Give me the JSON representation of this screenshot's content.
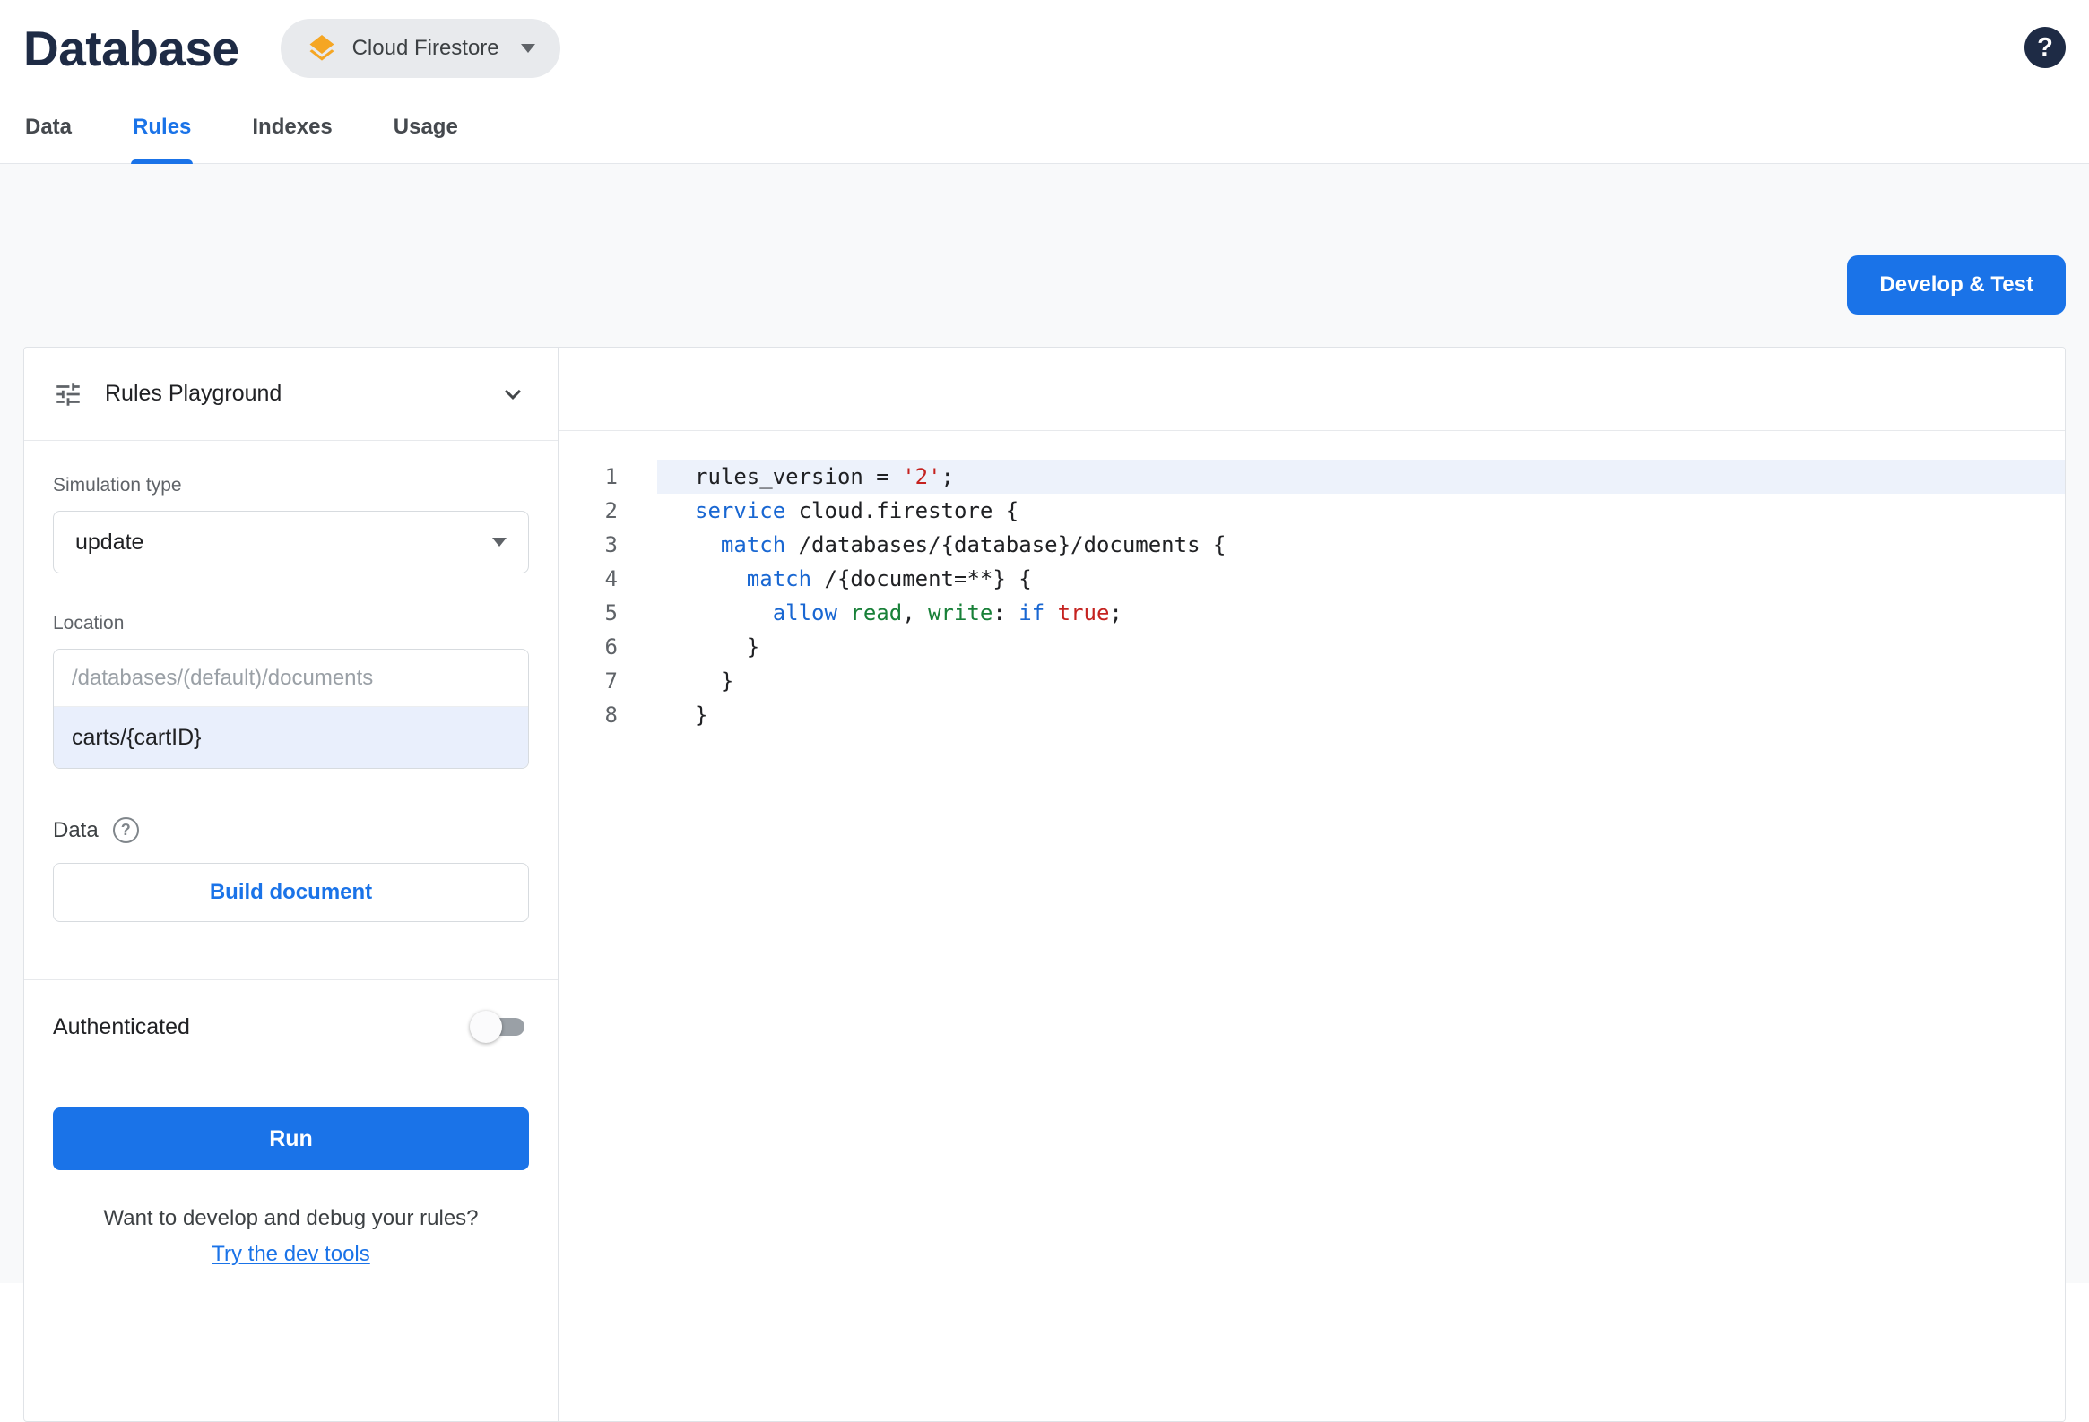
{
  "colors": {
    "accent_blue": "#1a73e8",
    "firestore_amber": "#f5a623",
    "active_line_bg": "#edf2fb",
    "syntax": {
      "kw": "#1967d2",
      "str": "#c5221f",
      "val": "#188038",
      "plain": "#202124"
    }
  },
  "header": {
    "title": "Database",
    "product_chip": "Cloud Firestore",
    "help_label": "?"
  },
  "tabs": [
    {
      "label": "Data",
      "active": false
    },
    {
      "label": "Rules",
      "active": true
    },
    {
      "label": "Indexes",
      "active": false
    },
    {
      "label": "Usage",
      "active": false
    }
  ],
  "toolbar": {
    "develop_test_label": "Develop & Test"
  },
  "playground": {
    "title": "Rules Playground",
    "simulation_type_label": "Simulation type",
    "simulation_type_value": "update",
    "location_label": "Location",
    "location_placeholder": "/databases/(default)/documents",
    "location_value": "carts/{cartID}",
    "data_label": "Data",
    "data_help_label": "?",
    "build_document_label": "Build document",
    "authenticated_label": "Authenticated",
    "authenticated_on": false,
    "run_label": "Run",
    "footer_question": "Want to develop and debug your rules?",
    "footer_link_label": "Try the dev tools"
  },
  "editor": {
    "active_line": 1,
    "lines": [
      {
        "n": 1,
        "tokens": [
          [
            "plain",
            "rules_version = "
          ],
          [
            "str",
            "'2'"
          ],
          [
            "plain",
            ";"
          ]
        ]
      },
      {
        "n": 2,
        "tokens": [
          [
            "kw",
            "service"
          ],
          [
            "plain",
            " cloud.firestore {"
          ]
        ]
      },
      {
        "n": 3,
        "tokens": [
          [
            "plain",
            "  "
          ],
          [
            "kw",
            "match"
          ],
          [
            "plain",
            " /databases/{database}/documents {"
          ]
        ]
      },
      {
        "n": 4,
        "tokens": [
          [
            "plain",
            "    "
          ],
          [
            "kw",
            "match"
          ],
          [
            "plain",
            " /{document=**} {"
          ]
        ]
      },
      {
        "n": 5,
        "tokens": [
          [
            "plain",
            "      "
          ],
          [
            "kw",
            "allow"
          ],
          [
            "plain",
            " "
          ],
          [
            "val",
            "read"
          ],
          [
            "plain",
            ", "
          ],
          [
            "val",
            "write"
          ],
          [
            "plain",
            ": "
          ],
          [
            "kw",
            "if"
          ],
          [
            "plain",
            " "
          ],
          [
            "str",
            "true"
          ],
          [
            "plain",
            ";"
          ]
        ]
      },
      {
        "n": 6,
        "tokens": [
          [
            "plain",
            "    }"
          ]
        ]
      },
      {
        "n": 7,
        "tokens": [
          [
            "plain",
            "  }"
          ]
        ]
      },
      {
        "n": 8,
        "tokens": [
          [
            "plain",
            "}"
          ]
        ]
      }
    ]
  }
}
